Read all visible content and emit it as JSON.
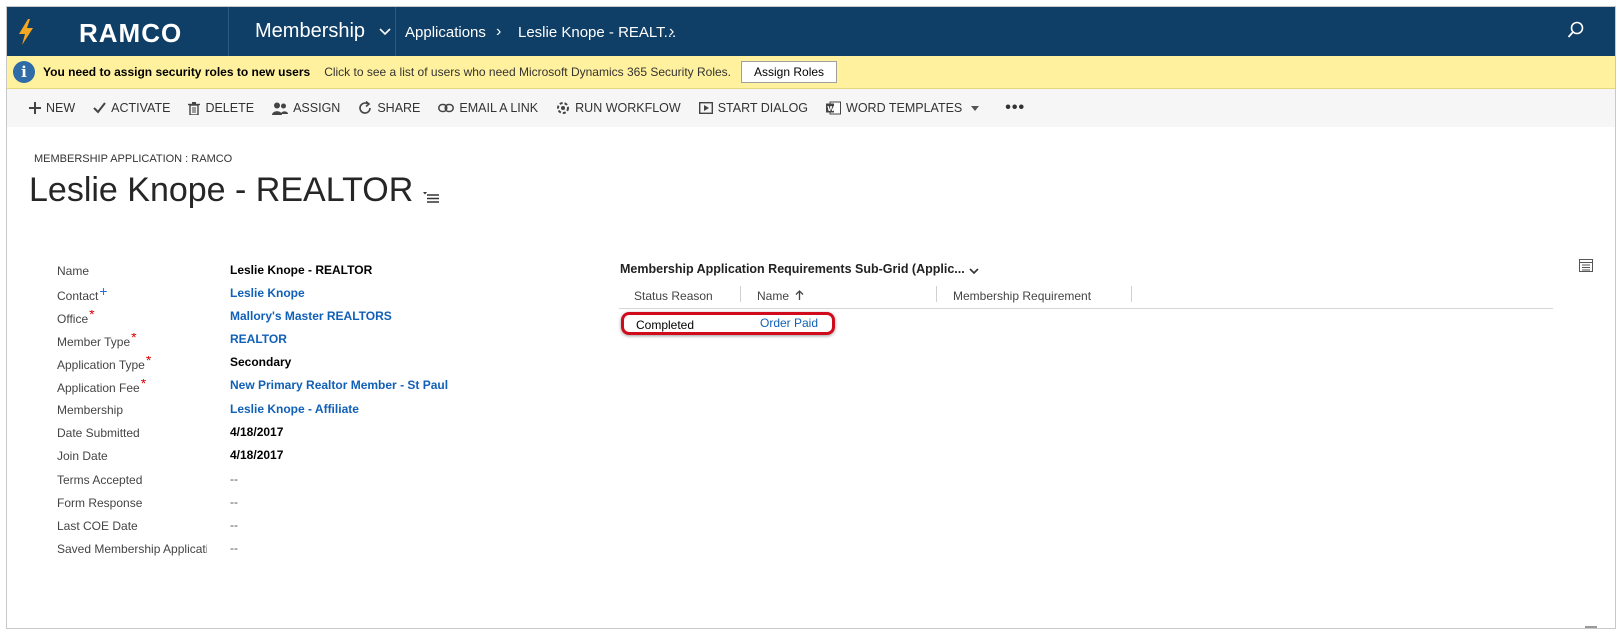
{
  "nav": {
    "brand": "RAMCO",
    "module": "Membership",
    "crumbs": [
      "Applications",
      "Leslie Knope - REALT..."
    ]
  },
  "notification": {
    "title": "You need to assign security roles to new users",
    "message": "Click to see a list of users who need Microsoft Dynamics 365 Security Roles.",
    "button": "Assign Roles"
  },
  "commands": {
    "new": "NEW",
    "activate": "ACTIVATE",
    "delete": "DELETE",
    "assign": "ASSIGN",
    "share": "SHARE",
    "email_link": "EMAIL A LINK",
    "run_workflow": "RUN WORKFLOW",
    "start_dialog": "START DIALOG",
    "word_templates": "WORD TEMPLATES"
  },
  "header": {
    "entity": "MEMBERSHIP APPLICATION : RAMCO",
    "title": "Leslie Knope - REALTOR"
  },
  "fields": {
    "name": {
      "label": "Name",
      "value": "Leslie Knope - REALTOR"
    },
    "contact": {
      "label": "Contact",
      "value": "Leslie Knope"
    },
    "office": {
      "label": "Office",
      "value": "Mallory's Master REALTORS"
    },
    "member_type": {
      "label": "Member Type",
      "value": "REALTOR"
    },
    "application_type": {
      "label": "Application Type",
      "value": "Secondary"
    },
    "application_fee": {
      "label": "Application Fee",
      "value": "New Primary Realtor Member - St Paul"
    },
    "membership": {
      "label": "Membership",
      "value": "Leslie Knope - Affiliate"
    },
    "date_submitted": {
      "label": "Date Submitted",
      "value": "4/18/2017"
    },
    "join_date": {
      "label": "Join Date",
      "value": "4/18/2017"
    },
    "terms_accepted": {
      "label": "Terms Accepted",
      "value": "--"
    },
    "form_response": {
      "label": "Form Response",
      "value": "--"
    },
    "last_coe_date": {
      "label": "Last COE Date",
      "value": "--"
    },
    "saved_membership": {
      "label": "Saved Membership Applicati",
      "value": "--"
    }
  },
  "subgrid": {
    "title": "Membership Application Requirements Sub-Grid (Applic...",
    "columns": [
      "Status Reason",
      "Name",
      "Membership Requirement"
    ],
    "rows": [
      {
        "status_reason": "Completed",
        "name": "Order Paid",
        "membership_requirement": ""
      }
    ]
  },
  "colors": {
    "nav_bg": "#0f3e66",
    "notify_bg": "#fff19d",
    "link": "#1160b7",
    "highlight": "#d00b1b",
    "required": "#dd0000"
  },
  "icons": [
    "lightning-icon",
    "search-icon",
    "info-icon",
    "plus-icon",
    "check-icon",
    "trash-icon",
    "people-icon",
    "share-icon",
    "link-icon",
    "workflow-icon",
    "dialog-icon",
    "word-icon",
    "more-icon",
    "chevron-down-icon",
    "grid-view-icon"
  ]
}
